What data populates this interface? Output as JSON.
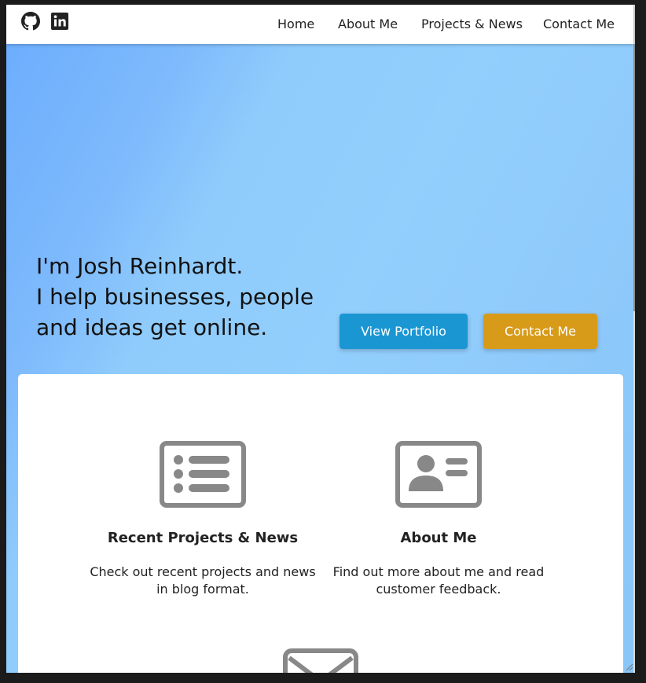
{
  "nav": {
    "items": [
      {
        "label": "Home"
      },
      {
        "label": "About Me"
      },
      {
        "label": "Projects & News"
      },
      {
        "label": "Contact Me"
      }
    ],
    "social_icons": [
      "github-icon",
      "linkedin-icon"
    ]
  },
  "hero": {
    "lines": [
      "I'm Josh Reinhardt.",
      "I help businesses, people",
      "and ideas get online."
    ],
    "buttons": {
      "portfolio": "View Portfolio",
      "contact": "Contact Me"
    }
  },
  "features": [
    {
      "icon": "list-card-icon",
      "title": "Recent Projects & News",
      "text": "Check out recent projects and news in blog format."
    },
    {
      "icon": "id-card-icon",
      "title": "About Me",
      "text": "Find out more about me and read customer feedback."
    },
    {
      "icon": "envelope-icon",
      "title": "",
      "text": ""
    }
  ],
  "colors": {
    "portfolio_button": "#1a96d3",
    "contact_button": "#d89a19",
    "hero_gradient_start": "#6daefd",
    "hero_gradient_end": "#8ac6f8",
    "icon_gray": "#888888"
  }
}
